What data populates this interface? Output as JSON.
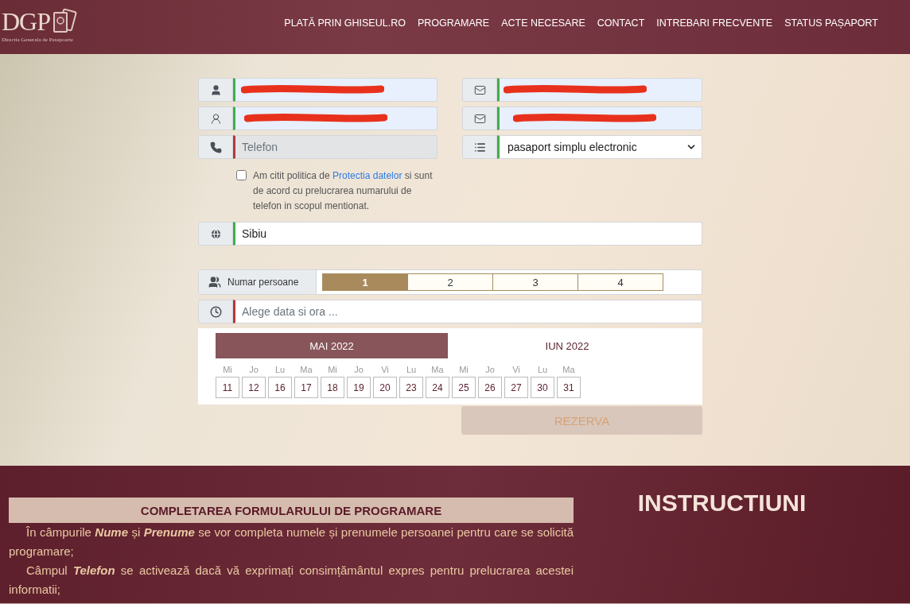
{
  "header": {
    "logo": {
      "letters": "DGP",
      "subtitle": "Directia Generala de Pasapoarte"
    },
    "nav": [
      {
        "label": "PLATĂ PRIN GHISEUL.RO"
      },
      {
        "label": "PROGRAMARE"
      },
      {
        "label": "ACTE NECESARE"
      },
      {
        "label": "CONTACT"
      },
      {
        "label": "INTREBARI FRECVENTE"
      },
      {
        "label": "STATUS PAȘAPORT"
      }
    ]
  },
  "form": {
    "left": [
      {
        "kind": "input",
        "redacted": true,
        "valid": true,
        "disabled": false
      },
      {
        "kind": "input",
        "redacted": true,
        "valid": true,
        "disabled": false
      },
      {
        "kind": "input",
        "redacted": false,
        "valid": false,
        "disabled": true,
        "placeholder": "Telefon"
      }
    ],
    "right": [
      {
        "kind": "input",
        "redacted": true,
        "valid": true,
        "disabled": false
      },
      {
        "kind": "input",
        "redacted": true,
        "valid": true,
        "disabled": false
      },
      {
        "kind": "select",
        "valid": true,
        "value": "pasaport simplu electronic"
      }
    ],
    "consent": {
      "checked": false,
      "before": "Am citit politica de",
      "link": "Protectia datelor",
      "after": "si sunt de acord cu prelucrarea numarului de telefon in scopul mentionat."
    },
    "city": {
      "value": "Sibiu",
      "valid": true
    },
    "persons": {
      "label": "Numar persoane",
      "options": [
        {
          "label": "1",
          "selected": true
        },
        {
          "label": "2",
          "selected": false
        },
        {
          "label": "3",
          "selected": false
        },
        {
          "label": "4",
          "selected": false
        }
      ]
    },
    "datetime": {
      "placeholder": "Alege data si ora ...",
      "valid": false
    },
    "calendar": {
      "months": [
        {
          "label": "MAI 2022",
          "selected": true
        },
        {
          "label": "IUN 2022",
          "selected": false
        }
      ],
      "days": [
        {
          "weekday": "Mi",
          "date": "11"
        },
        {
          "weekday": "Jo",
          "date": "12"
        },
        {
          "weekday": "Lu",
          "date": "16"
        },
        {
          "weekday": "Ma",
          "date": "17"
        },
        {
          "weekday": "Mi",
          "date": "18"
        },
        {
          "weekday": "Jo",
          "date": "19"
        },
        {
          "weekday": "Vi",
          "date": "20"
        },
        {
          "weekday": "Lu",
          "date": "23"
        },
        {
          "weekday": "Ma",
          "date": "24"
        },
        {
          "weekday": "Mi",
          "date": "25"
        },
        {
          "weekday": "Jo",
          "date": "26"
        },
        {
          "weekday": "Vi",
          "date": "27"
        },
        {
          "weekday": "Lu",
          "date": "30"
        },
        {
          "weekday": "Ma",
          "date": "31"
        }
      ]
    },
    "submit": {
      "label": "REZERVA",
      "disabled": true
    }
  },
  "instructions": {
    "heading": "COMPLETAREA FORMULARULUI DE PROGRAMARE",
    "title": "INSTRUCTIUNI",
    "paragraphs": [
      "În câmpurile **Nume** și **Prenume** se vor completa numele și prenumele persoanei pentru care se solicită programare;",
      "Câmpul **Telefon** se activează dacă vă exprimați consimțământul expres pentru prelucrarea acestei informatii;"
    ]
  }
}
